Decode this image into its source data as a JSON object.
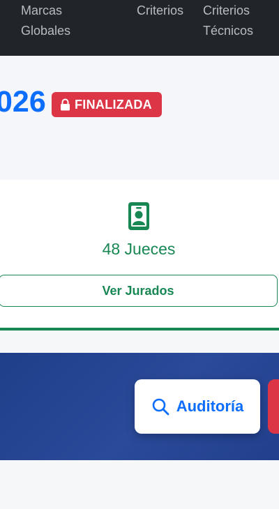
{
  "nav": {
    "items": [
      {
        "label": "Marcas\nGlobales"
      },
      {
        "label": "Criterios"
      },
      {
        "label": "Criterios\nTécnicos"
      }
    ]
  },
  "header": {
    "year_fragment": "026",
    "status_badge": "FINALIZADA"
  },
  "judges": {
    "count_label": "48 Jueces",
    "button_label": "Ver Jurados"
  },
  "actions": {
    "audit_label": "Auditoría"
  },
  "colors": {
    "nav_bg": "#212529",
    "primary": "#0d6efd",
    "success": "#198754",
    "danger": "#dc3545",
    "band_blue": "#243f8c"
  },
  "icons": [
    "lock-icon",
    "id-badge-icon",
    "search-icon"
  ]
}
